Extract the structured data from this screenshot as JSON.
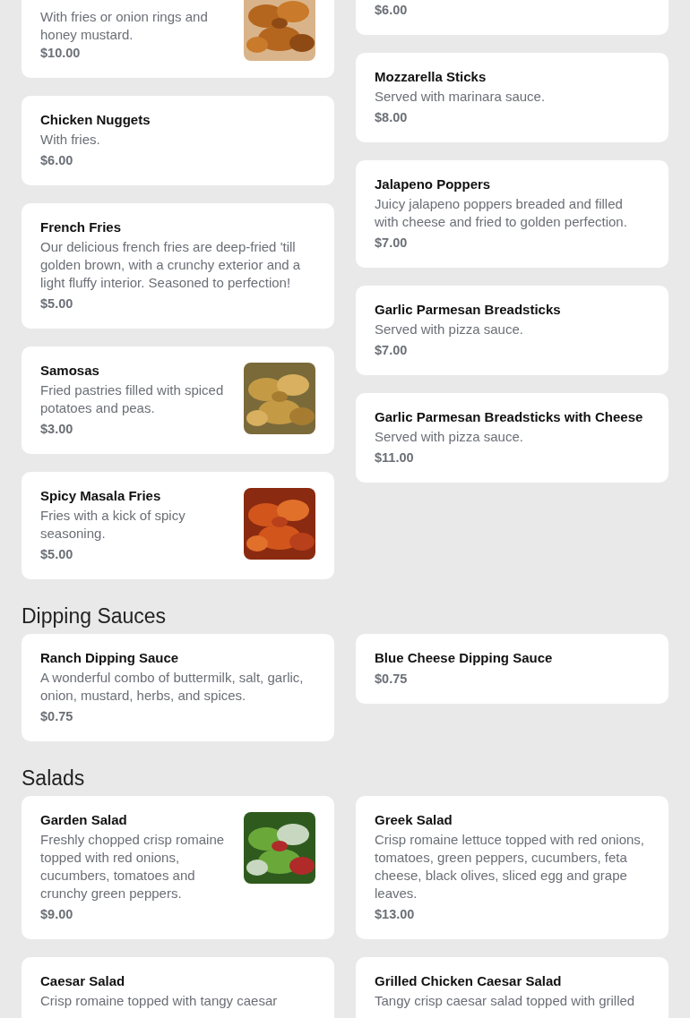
{
  "sections": [
    {
      "columns": [
        [
          {
            "description": "With fries or onion rings and honey mustard.",
            "price": "$10.00"
          },
          {
            "name": "Chicken Nuggets",
            "description": "With fries.",
            "price": "$6.00"
          },
          {
            "name": "French Fries",
            "description": "Our delicious french fries are deep-fried 'till golden brown, with a crunchy exterior and a light fluffy interior. Seasoned to perfection!",
            "price": "$5.00"
          },
          {
            "name": "Samosas",
            "description": "Fried pastries filled with spiced potatoes and peas.",
            "price": "$3.00"
          },
          {
            "name": "Spicy Masala Fries",
            "description": "Fries with a kick of spicy seasoning.",
            "price": "$5.00"
          }
        ],
        [
          {
            "price": "$6.00"
          },
          {
            "name": "Mozzarella Sticks",
            "description": "Served with marinara sauce.",
            "price": "$8.00"
          },
          {
            "name": "Jalapeno Poppers",
            "description": "Juicy jalapeno poppers breaded and filled with cheese and fried to golden perfection.",
            "price": "$7.00"
          },
          {
            "name": "Garlic Parmesan Breadsticks",
            "description": "Served with pizza sauce.",
            "price": "$7.00"
          },
          {
            "name": "Garlic Parmesan Breadsticks with Cheese",
            "description": "Served with pizza sauce.",
            "price": "$11.00"
          }
        ]
      ]
    },
    {
      "title": "Dipping Sauces",
      "columns": [
        [
          {
            "name": "Ranch Dipping Sauce",
            "description": "A wonderful combo of buttermilk, salt, garlic, onion, mustard, herbs, and spices.",
            "price": "$0.75"
          }
        ],
        [
          {
            "name": "Blue Cheese Dipping Sauce",
            "price": "$0.75"
          }
        ]
      ]
    },
    {
      "title": "Salads",
      "columns": [
        [
          {
            "name": "Garden Salad",
            "description": "Freshly chopped crisp romaine topped with red onions, cucumbers, tomatoes and crunchy green peppers.",
            "price": "$9.00"
          },
          {
            "name": "Caesar Salad",
            "description": "Crisp romaine topped with tangy caesar"
          }
        ],
        [
          {
            "name": "Greek Salad",
            "description": "Crisp romaine lettuce topped with red onions, tomatoes, green peppers, cucumbers, feta cheese, black olives, sliced egg and grape leaves.",
            "price": "$13.00"
          },
          {
            "name": "Grilled Chicken Caesar Salad",
            "description": "Tangy crisp caesar salad topped with grilled"
          }
        ]
      ]
    }
  ]
}
